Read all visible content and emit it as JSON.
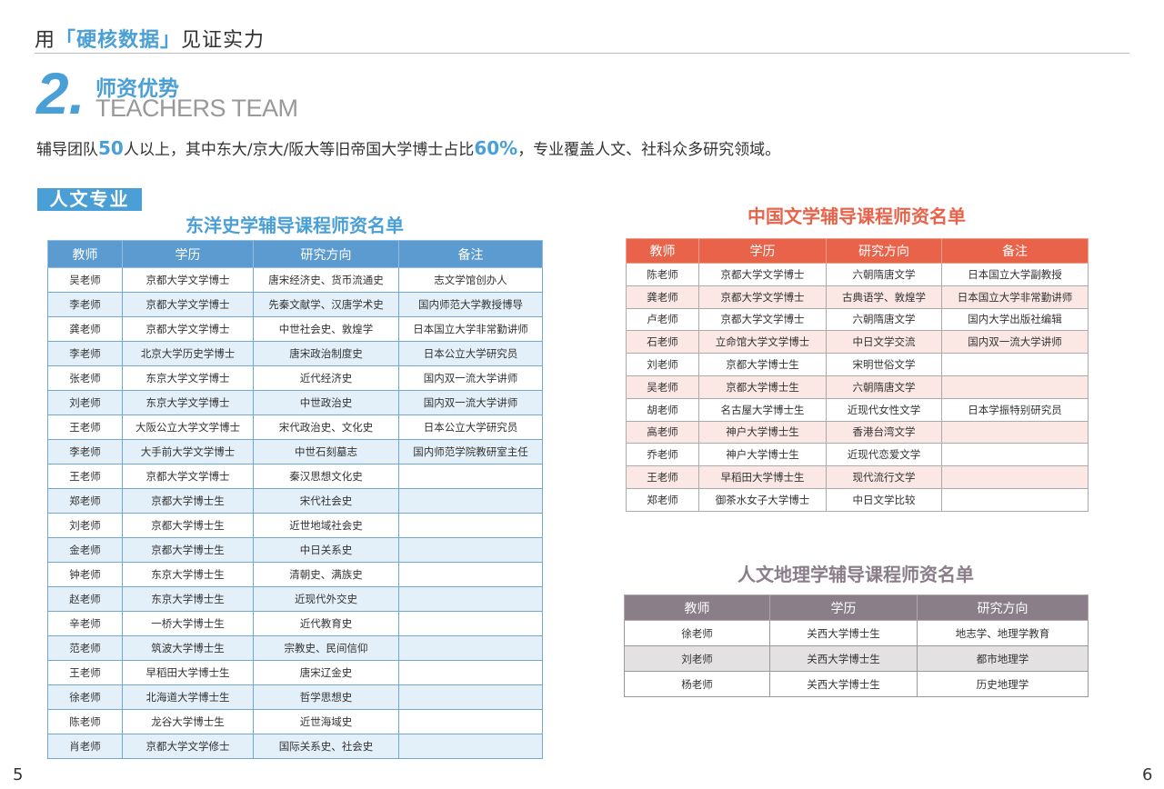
{
  "header": {
    "prefix": "用",
    "highlight": "「硬核数据」",
    "suffix": "见证实力"
  },
  "section": {
    "number": "2.",
    "title_cn": "师资优势",
    "title_en": "TEACHERS TEAM"
  },
  "intro": {
    "part1": "辅导团队",
    "num1": "50",
    "part2": "人以上，其中东大/京大/阪大等旧帝国大学博士占比",
    "num2": "60%",
    "part3": "，专业覆盖人文、社科众多研究领域。"
  },
  "tag": "人文专业",
  "table1": {
    "title": "东洋史学辅导课程师资名单",
    "headers": [
      "教师",
      "学历",
      "研究方向",
      "备注"
    ],
    "rows": [
      [
        "吴老师",
        "京都大学文学博士",
        "唐宋经济史、货币流通史",
        "志文学馆创办人"
      ],
      [
        "李老师",
        "京都大学文学博士",
        "先秦文献学、汉唐学术史",
        "国内师范大学教授博导"
      ],
      [
        "龚老师",
        "京都大学文学博士",
        "中世社会史、敦煌学",
        "日本国立大学非常勤讲师"
      ],
      [
        "李老师",
        "北京大学历史学博士",
        "唐宋政治制度史",
        "日本公立大学研究员"
      ],
      [
        "张老师",
        "东京大学文学博士",
        "近代经济史",
        "国内双一流大学讲师"
      ],
      [
        "刘老师",
        "东京大学文学博士",
        "中世政治史",
        "国内双一流大学讲师"
      ],
      [
        "王老师",
        "大阪公立大学文学博士",
        "宋代政治史、文化史",
        "日本公立大学研究员"
      ],
      [
        "李老师",
        "大手前大学文学博士",
        "中世石刻墓志",
        "国内师范学院教研室主任"
      ],
      [
        "王老师",
        "京都大学文学博士",
        "秦汉思想文化史",
        ""
      ],
      [
        "郑老师",
        "京都大学博士生",
        "宋代社会史",
        ""
      ],
      [
        "刘老师",
        "京都大学博士生",
        "近世地域社会史",
        ""
      ],
      [
        "金老师",
        "京都大学博士生",
        "中日关系史",
        ""
      ],
      [
        "钟老师",
        "东京大学博士生",
        "清朝史、满族史",
        ""
      ],
      [
        "赵老师",
        "东京大学博士生",
        "近现代外交史",
        ""
      ],
      [
        "辛老师",
        "一桥大学博士生",
        "近代教育史",
        ""
      ],
      [
        "范老师",
        "筑波大学博士生",
        "宗教史、民间信仰",
        ""
      ],
      [
        "王老师",
        "早稻田大学博士生",
        "唐宋辽金史",
        ""
      ],
      [
        "徐老师",
        "北海道大学博士生",
        "哲学思想史",
        ""
      ],
      [
        "陈老师",
        "龙谷大学博士生",
        "近世海域史",
        ""
      ],
      [
        "肖老师",
        "京都大学文学修士",
        "国际关系史、社会史",
        ""
      ]
    ]
  },
  "table2": {
    "title": "中国文学辅导课程师资名单",
    "headers": [
      "教师",
      "学历",
      "研究方向",
      "备注"
    ],
    "rows": [
      [
        "陈老师",
        "京都大学文学博士",
        "六朝隋唐文学",
        "日本国立大学副教授"
      ],
      [
        "龚老师",
        "京都大学文学博士",
        "古典语学、敦煌学",
        "日本国立大学非常勤讲师"
      ],
      [
        "卢老师",
        "京都大学文学博士",
        "六朝隋唐文学",
        "国内大学出版社编辑"
      ],
      [
        "石老师",
        "立命馆大学文学博士",
        "中日文学交流",
        "国内双一流大学讲师"
      ],
      [
        "刘老师",
        "京都大学博士生",
        "宋明世俗文学",
        ""
      ],
      [
        "吴老师",
        "京都大学博士生",
        "六朝隋唐文学",
        ""
      ],
      [
        "胡老师",
        "名古屋大学博士生",
        "近现代女性文学",
        "日本学振特别研究员"
      ],
      [
        "高老师",
        "神户大学博士生",
        "香港台湾文学",
        ""
      ],
      [
        "乔老师",
        "神户大学博士生",
        "近现代恋爱文学",
        ""
      ],
      [
        "王老师",
        "早稻田大学博士生",
        "现代流行文学",
        ""
      ],
      [
        "郑老师",
        "御茶水女子大学博士",
        "中日文学比较",
        ""
      ]
    ]
  },
  "table3": {
    "title": "人文地理学辅导课程师资名单",
    "headers": [
      "教师",
      "学历",
      "研究方向"
    ],
    "rows": [
      [
        "徐老师",
        "关西大学博士生",
        "地志学、地理学教育"
      ],
      [
        "刘老师",
        "关西大学博士生",
        "都市地理学"
      ],
      [
        "杨老师",
        "关西大学博士生",
        "历史地理学"
      ]
    ]
  },
  "page_numbers": {
    "left": "5",
    "right": "6"
  }
}
